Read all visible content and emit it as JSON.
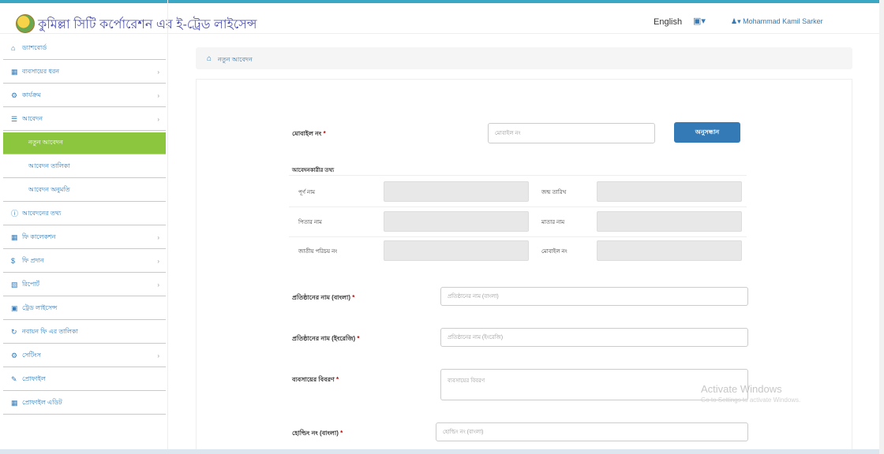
{
  "header": {
    "title": "কুমিল্লা সিটি কর্পোরেশন এর ই-ট্রেড লাইসেন্স",
    "lang_link": "English",
    "briefcase_menu": "▾",
    "user_menu": "▾ Mohammad Kamil Sarker"
  },
  "sidebar": {
    "items": [
      {
        "label": "ড্যাশবোর্ড"
      },
      {
        "label": "ব্যবসায়ের ধরন"
      },
      {
        "label": "কার্যক্রম"
      },
      {
        "label": "আবেদন"
      },
      {
        "label": "নতুন আবেদন"
      },
      {
        "label": "আবেদন তালিকা"
      },
      {
        "label": "আবেদন অনুমতি"
      },
      {
        "label": "আবেদনের তথ্য"
      },
      {
        "label": "ফি কালেকশন"
      },
      {
        "label": "ফি প্রদান"
      },
      {
        "label": "রিপোর্ট"
      },
      {
        "label": "ট্রেড লাইসেন্স"
      },
      {
        "label": "নবায়ন ফি এর তালিকা"
      },
      {
        "label": "সেটিংস"
      },
      {
        "label": "প্রোফাইল"
      },
      {
        "label": "প্রোফাইল এডিট"
      }
    ]
  },
  "breadcrumb": {
    "label": "নতুন আবেদন"
  },
  "form": {
    "mobile_label": "মোবাইল নং",
    "mobile_placeholder": "মোবাইল নং",
    "search_label": "অনুসন্ধান",
    "info_heading": "আবেদনকারীর তথ্য",
    "info_rows": [
      {
        "left": "পূর্ণ নাম",
        "right": "জন্ম তারিখ"
      },
      {
        "left": "পিতার নাম",
        "right": "মাতার নাম"
      },
      {
        "left": "জাতীয় পরিচয় নং",
        "right": "মোবাইল নং"
      }
    ],
    "org_bn_label": "প্রতিষ্ঠানের নাম (বাংলা)",
    "org_bn_placeholder": "প্রতিষ্ঠানের নাম (বাংলা)",
    "org_en_label": "প্রতিষ্ঠানের নাম (ইংরেজি)",
    "org_en_placeholder": "প্রতিষ্ঠানের নাম (ইংরেজি)",
    "business_label": "ব্যবসায়ের বিবরণ",
    "business_placeholder": "ব্যবসায়ের বিবরণ",
    "holding_label": "হোল্ডিং নং (বাংলা)",
    "holding_placeholder": "হোল্ডিং নং (বাংলা)",
    "required_mark": "*"
  },
  "watermark": {
    "line1": "Activate Windows",
    "line2": "Go to Settings to activate Windows."
  }
}
